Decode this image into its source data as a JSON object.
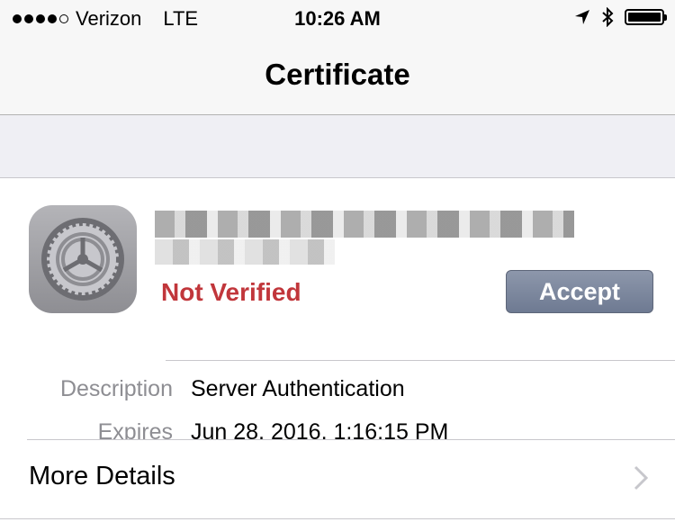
{
  "status_bar": {
    "carrier": "Verizon",
    "network": "LTE",
    "time": "10:26 AM",
    "signal_bars_filled": 4,
    "signal_bars_total": 5,
    "battery_level": 1.0
  },
  "nav": {
    "title": "Certificate"
  },
  "certificate": {
    "icon": "settings-gear-icon",
    "status": "Not Verified",
    "status_color": "#c1363b",
    "accept_label": "Accept"
  },
  "details": {
    "description_label": "Description",
    "description_value": "Server Authentication",
    "expires_label": "Expires",
    "expires_value": "Jun 28, 2016, 1:16:15 PM"
  },
  "more_details": {
    "label": "More Details"
  },
  "colors": {
    "accent_button": "#7b869d",
    "background_gray": "#efeff4"
  }
}
